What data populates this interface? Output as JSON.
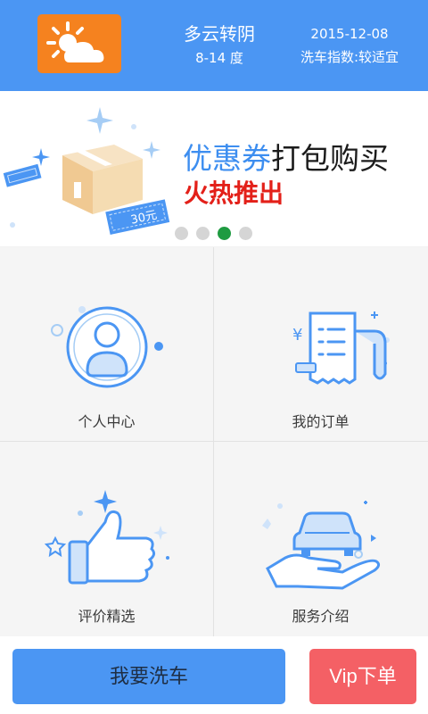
{
  "header": {
    "weather_condition": "多云转阴",
    "temperature": "8-14 度",
    "date": "2015-12-08",
    "wash_index": "洗车指数:较适宜",
    "weather_icon": "partly-cloudy-icon"
  },
  "banner": {
    "title_highlight": "优惠券",
    "title_rest": "打包购买",
    "subtitle": "火热推出",
    "coupon_text": "30元",
    "dots_total": 4,
    "active_dot": 3
  },
  "grid": {
    "items": [
      {
        "label": "个人中心",
        "icon": "user-profile-icon"
      },
      {
        "label": "我的订单",
        "icon": "receipt-order-icon"
      },
      {
        "label": "评价精选",
        "icon": "thumbs-up-icon"
      },
      {
        "label": "服务介绍",
        "icon": "car-in-hand-icon"
      }
    ]
  },
  "bottom": {
    "wash_button": "我要洗车",
    "vip_button": "Vip下单"
  },
  "colors": {
    "primary": "#4b96f3",
    "weather_box": "#f5821f",
    "vip": "#f46065",
    "promo_red": "#e32019",
    "active_dot": "#1f9b41"
  }
}
